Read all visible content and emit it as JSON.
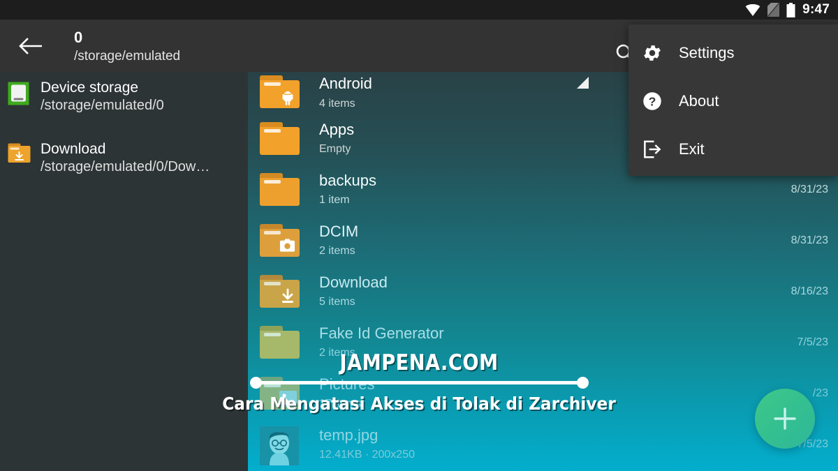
{
  "statusbar": {
    "time": "9:47",
    "icons": [
      "wifi-icon",
      "no-sim-icon",
      "battery-icon"
    ]
  },
  "toolbar": {
    "back_icon": "back-arrow-icon",
    "title": "0",
    "subtitle": "/storage/emulated",
    "search_icon": "search-icon",
    "resize_handle_icon": "resize-handle-icon"
  },
  "menu": {
    "items": [
      {
        "label": "Settings",
        "icon": "gear-icon"
      },
      {
        "label": "About",
        "icon": "question-circle-icon"
      },
      {
        "label": "Exit",
        "icon": "exit-icon"
      }
    ]
  },
  "sidebar": {
    "items": [
      {
        "title": "Device storage",
        "path": "/storage/emulated/0",
        "icon": "device-storage-icon",
        "color": "#3faa1e"
      },
      {
        "title": "Download",
        "path": "/storage/emulated/0/Dow…",
        "icon": "download-folder-icon",
        "color": "#eda32c"
      }
    ]
  },
  "filelist": {
    "rows": [
      {
        "name": "Android",
        "sub": "4 items",
        "date": "",
        "icon": "android-folder-icon",
        "kind": "folder",
        "badge": "android"
      },
      {
        "name": "Apps",
        "sub": "Empty",
        "date": "",
        "icon": "folder-icon",
        "kind": "folder",
        "badge": ""
      },
      {
        "name": "backups",
        "sub": "1 item",
        "date": "8/31/23",
        "icon": "folder-icon",
        "kind": "folder",
        "badge": ""
      },
      {
        "name": "DCIM",
        "sub": "2 items",
        "date": "8/31/23",
        "icon": "camera-folder-icon",
        "kind": "folder",
        "badge": "camera"
      },
      {
        "name": "Download",
        "sub": "5 items",
        "date": "8/16/23",
        "icon": "download-folder-icon",
        "kind": "folder",
        "badge": "download"
      },
      {
        "name": "Fake Id Generator",
        "sub": "2 items",
        "date": "7/5/23",
        "icon": "folder-icon",
        "kind": "folder",
        "badge": ""
      },
      {
        "name": "Pictures",
        "sub": "17 items",
        "date": "/23",
        "icon": "pictures-folder-icon",
        "kind": "folder",
        "badge": "image"
      },
      {
        "name": "temp.jpg",
        "sub": "12.41KB      ·      200x250",
        "date": "7/5/23",
        "icon": "image-thumbnail",
        "kind": "file",
        "badge": ""
      }
    ]
  },
  "fab": {
    "icon": "plus-icon",
    "color": "#35c08f"
  },
  "watermark": {
    "brand": "JAMPENA.COM",
    "subtitle": "Cara Mengatasi Akses di Tolak di Zarchiver"
  },
  "theme": {
    "toolbar_bg": "#333333",
    "statusbar_bg": "#1d1d1d",
    "sidebar_bg": "#2d3436",
    "menu_bg": "#373737",
    "gradient_top": "#2b393c",
    "gradient_bottom": "#03aece",
    "folder_orange": "#f2a12a"
  }
}
